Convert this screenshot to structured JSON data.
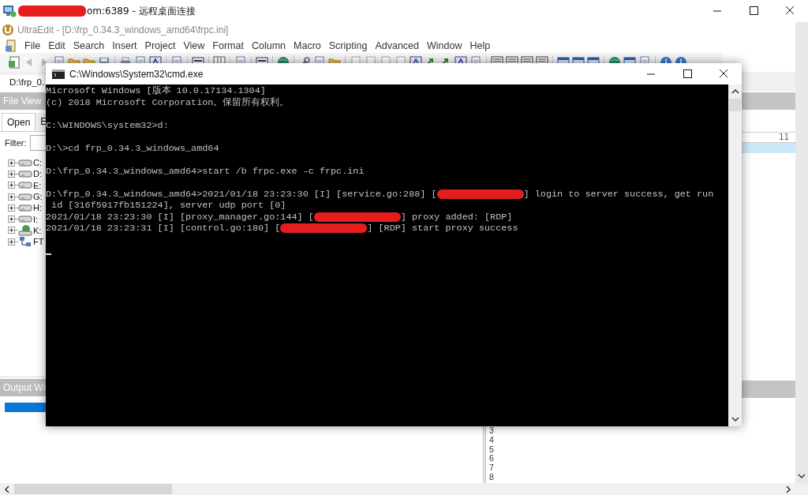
{
  "remote_window": {
    "title_parts": [
      {
        "kind": "redacted"
      },
      {
        "kind": "text",
        "text": "om:6389 - 远程桌面连接"
      }
    ]
  },
  "editor_app": {
    "title": "UltraEdit - [D:\\frp_0.34.3_windows_amd64\\frpc.ini]",
    "menu": [
      "File",
      "Edit",
      "Search",
      "Insert",
      "Project",
      "View",
      "Format",
      "Column",
      "Macro",
      "Scripting",
      "Advanced",
      "Window",
      "Help"
    ],
    "document_tab": "D:\\frp_0.",
    "file_view": {
      "title": "File View",
      "tabs": [
        {
          "label": "Open",
          "selected": true
        },
        {
          "label": "E",
          "selected": false
        }
      ],
      "filter_label": "Filter:",
      "tree": [
        {
          "label": "C:",
          "kind": "drive",
          "expanded": false
        },
        {
          "label": "D:",
          "kind": "drive",
          "expanded": false
        },
        {
          "label": "E:",
          "kind": "drive",
          "expanded": false
        },
        {
          "label": "G:",
          "kind": "drive",
          "expanded": false
        },
        {
          "label": "H:",
          "kind": "drive",
          "expanded": false
        },
        {
          "label": "I:",
          "kind": "drive",
          "expanded": false
        },
        {
          "label": "K:",
          "kind": "network",
          "expanded": false
        },
        {
          "label": "FT",
          "kind": "ftp",
          "expanded": false
        }
      ]
    },
    "output_window": {
      "title": "Output Wi"
    },
    "editor": {
      "ruler_label": "11",
      "line_numbers": [
        "3",
        "4",
        "5",
        "6",
        "7",
        "8"
      ]
    }
  },
  "console_window": {
    "title": "C:\\Windows\\System32\\cmd.exe",
    "blocks": [
      [
        {
          "parts": [
            {
              "kind": "text",
              "text": "Microsoft Windows [版本 10.0.17134.1304]"
            }
          ]
        },
        {
          "parts": [
            {
              "kind": "text",
              "text": "(c) 2018 Microsoft Corporation。保留所有权利。"
            }
          ]
        }
      ],
      [
        {
          "parts": [
            {
              "kind": "text",
              "text": "C:\\WINDOWS\\system32>d:"
            }
          ]
        }
      ],
      [
        {
          "parts": [
            {
              "kind": "text",
              "text": "D:\\>cd frp_0.34.3_windows_amd64"
            }
          ]
        }
      ],
      [
        {
          "parts": [
            {
              "kind": "text",
              "text": "D:\\frp_0.34.3_windows_amd64>start /b frpc.exe -c frpc.ini"
            }
          ]
        }
      ],
      [
        {
          "parts": [
            {
              "kind": "text",
              "text": "D:\\frp_0.34.3_windows_amd64>2021/01/18 23:23:30 [I] [service.go:288] ["
            },
            {
              "kind": "redacted"
            },
            {
              "kind": "text",
              "text": "] login to server success, get run"
            }
          ]
        },
        {
          "parts": [
            {
              "kind": "text",
              "text": " id [316f5917fb151224], server udp port [0]"
            }
          ]
        },
        {
          "parts": [
            {
              "kind": "text",
              "text": "2021/01/18 23:23:30 [I] [proxy_manager.go:144] ["
            },
            {
              "kind": "redacted"
            },
            {
              "kind": "text",
              "text": "] proxy added: [RDP]"
            }
          ]
        },
        {
          "parts": [
            {
              "kind": "text",
              "text": "2021/01/18 23:23:31 [I] [control.go:180] ["
            },
            {
              "kind": "redacted"
            },
            {
              "kind": "text",
              "text": "] [RDP] start proxy success"
            }
          ]
        }
      ]
    ],
    "cursor": true
  }
}
